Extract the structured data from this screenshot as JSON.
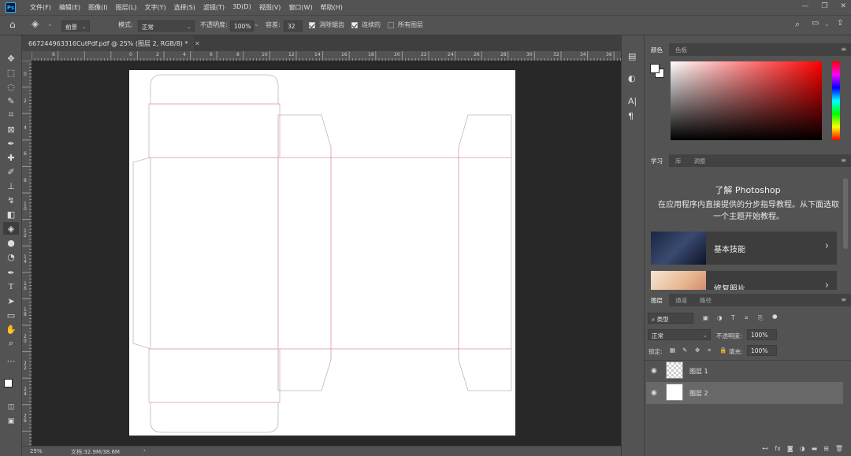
{
  "app": {
    "logo": "Ps"
  },
  "menu": [
    "文件(F)",
    "编辑(E)",
    "图像(I)",
    "图层(L)",
    "文字(Y)",
    "选择(S)",
    "滤镜(T)",
    "3D(D)",
    "视图(V)",
    "窗口(W)",
    "帮助(H)"
  ],
  "window_controls": {
    "minimize": "—",
    "restore": "❐",
    "close": "✕"
  },
  "options": {
    "fill_source": "前景",
    "mode_label": "模式:",
    "mode_value": "正常",
    "opacity_label": "不透明度:",
    "opacity_value": "100%",
    "tolerance_label": "容差:",
    "tolerance_value": "32",
    "antialias_label": "消除锯齿",
    "contiguous_label": "连续的",
    "all_layers_label": "所有图层"
  },
  "document": {
    "tab_title": "667244963316CutPdf.pdf @ 25% (图层 2, RGB/8) *",
    "close": "✕",
    "ruler_top_labels": [
      "6",
      "0",
      "2",
      "4",
      "6",
      "8",
      "10",
      "12",
      "14",
      "16",
      "18",
      "20",
      "22",
      "24",
      "26",
      "28",
      "30",
      "32",
      "34",
      "36"
    ],
    "ruler_left_labels": [
      "0",
      "2",
      "4",
      "6",
      "8",
      "1\n0",
      "1\n2",
      "1\n4",
      "1\n6",
      "1\n8",
      "2\n0",
      "2\n2",
      "2\n4",
      "2\n6"
    ]
  },
  "status": {
    "zoom": "25%",
    "doc_info": "文档:32.9M/38.6M",
    "arrow": "›"
  },
  "color_panel": {
    "tabs": [
      "颜色",
      "色板"
    ],
    "colors": {
      "hue_top": "#ff0000"
    }
  },
  "learn_panel": {
    "tabs": [
      "学习",
      "库",
      "调整"
    ],
    "title": "了解 Photoshop",
    "description": "在应用程序内直接提供的分步指导教程。从下面选取一个主题开始教程。",
    "cards": [
      {
        "label": "基本技能"
      },
      {
        "label": "修复照片"
      }
    ]
  },
  "layers_panel": {
    "tabs": [
      "图层",
      "通道",
      "路径"
    ],
    "filter_kind": "类型",
    "blend_mode": "正常",
    "opacity_label": "不透明度:",
    "opacity_value": "100%",
    "lock_label": "锁定:",
    "fill_label": "填充:",
    "fill_value": "100%",
    "layers": [
      {
        "name": "图层 1",
        "selected": false
      },
      {
        "name": "图层 2",
        "selected": true
      }
    ],
    "footer_icons": [
      "link-icon",
      "fx-icon",
      "mask-icon",
      "adjustment-icon",
      "group-icon",
      "new-layer-icon",
      "trash-icon"
    ]
  }
}
